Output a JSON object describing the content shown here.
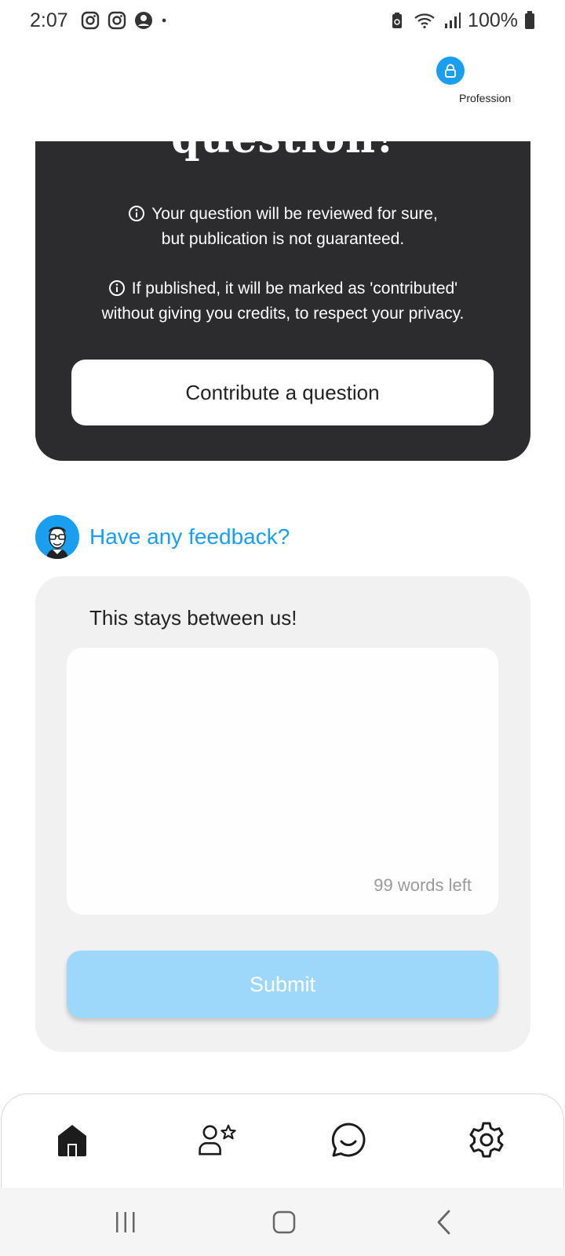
{
  "status_bar": {
    "time": "2:07",
    "battery": "100%",
    "icons": [
      "instagram-icon",
      "instagram-icon",
      "account-icon",
      "dot-icon",
      "battery-saver-icon",
      "wifi-icon",
      "signal-icon",
      "battery-icon"
    ]
  },
  "header": {
    "profession_label": "Profession",
    "profession_icon": "lock-icon",
    "accent": "#1a9ef0"
  },
  "contribute_card": {
    "title": "question!",
    "note_1_line_1": "Your question will be reviewed for sure,",
    "note_1_line_2": "but publication is not guaranteed.",
    "note_2_line_1": "If published, it will be marked as 'contributed'",
    "note_2_line_2": "without giving you credits, to respect your privacy.",
    "button_label": "Contribute a question",
    "background": "#2c2c2e"
  },
  "feedback": {
    "heading": "Have any feedback?",
    "subheading": "This stays between us!",
    "textarea_value": "",
    "words_left": "99 words left",
    "submit_label": "Submit",
    "submit_color": "#9dd8fb"
  },
  "bottom_nav": {
    "items": [
      {
        "icon": "home-icon",
        "active": true
      },
      {
        "icon": "person-star-icon",
        "active": false
      },
      {
        "icon": "chat-bubble-icon",
        "active": false
      },
      {
        "icon": "gear-icon",
        "active": false
      }
    ]
  },
  "system_nav": {
    "buttons": [
      "recent-apps-icon",
      "home-button-icon",
      "back-icon"
    ]
  }
}
